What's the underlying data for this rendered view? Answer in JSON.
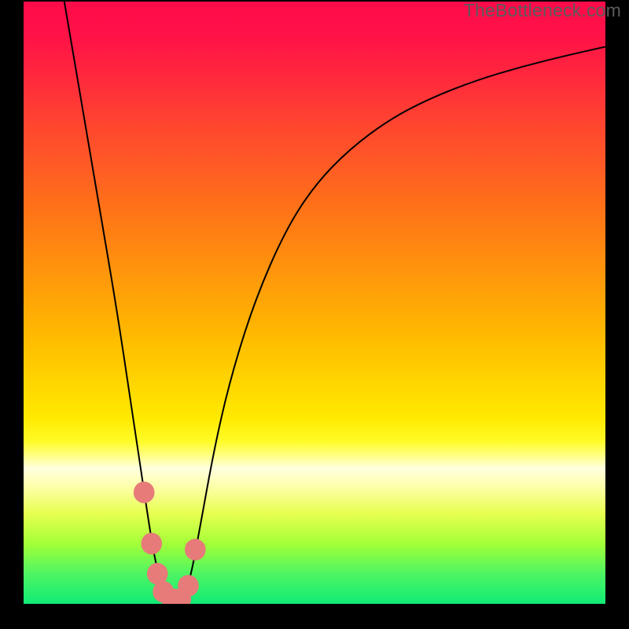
{
  "watermark": "TheBottleneck.com",
  "chart_data": {
    "type": "line",
    "title": "",
    "xlabel": "",
    "ylabel": "",
    "xlim": [
      0,
      100
    ],
    "ylim": [
      0,
      100
    ],
    "series": [
      {
        "name": "bottleneck-curve",
        "x": [
          7,
          10,
          13,
          16,
          18.5,
          20.5,
          22,
          23,
          24,
          25.5,
          27,
          28.5,
          30,
          33,
          36,
          40,
          45,
          50,
          56,
          63,
          70,
          78,
          86,
          94,
          100
        ],
        "y": [
          100,
          83,
          66,
          49,
          33,
          20,
          10.5,
          5.5,
          2,
          0.5,
          0.5,
          3.5,
          11,
          27,
          39,
          51,
          62,
          69.5,
          75.5,
          80.5,
          84,
          87,
          89.3,
          91.2,
          92.5
        ]
      }
    ],
    "markers": [
      {
        "name": "left-dot",
        "x": 20.7,
        "y": 18.5,
        "r": 1.8,
        "color": "#e67b79"
      },
      {
        "name": "dip-left-1",
        "x": 22.0,
        "y": 10.0,
        "r": 1.8,
        "color": "#e67b79"
      },
      {
        "name": "dip-left-2",
        "x": 23.0,
        "y": 5.0,
        "r": 1.8,
        "color": "#e67b79"
      },
      {
        "name": "dip-bottom-1",
        "x": 24.0,
        "y": 2.0,
        "r": 1.8,
        "color": "#e67b79"
      },
      {
        "name": "dip-bottom-2",
        "x": 25.5,
        "y": 0.8,
        "r": 1.8,
        "color": "#e67b79"
      },
      {
        "name": "dip-bottom-3",
        "x": 27.0,
        "y": 0.8,
        "r": 1.8,
        "color": "#e67b79"
      },
      {
        "name": "dip-right-1",
        "x": 28.3,
        "y": 3.0,
        "r": 1.8,
        "color": "#e67b79"
      },
      {
        "name": "right-dot",
        "x": 29.5,
        "y": 9.0,
        "r": 1.8,
        "color": "#e67b79"
      }
    ],
    "background_gradient": {
      "top_color": "#ff0a4a",
      "bottom_color": "#10eb76"
    }
  }
}
